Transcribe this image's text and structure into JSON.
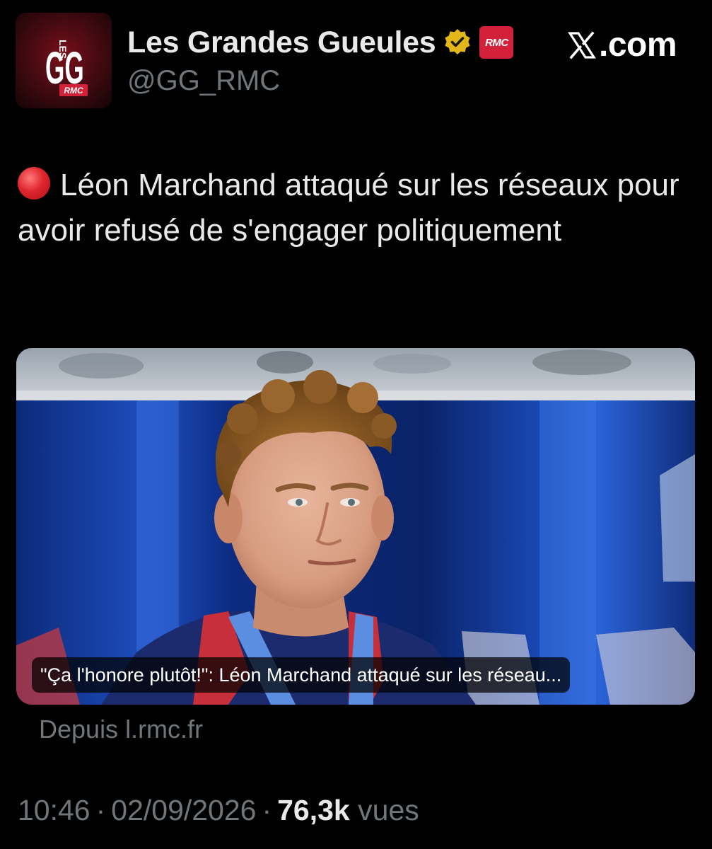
{
  "header": {
    "author_name": "Les Grandes Gueules",
    "author_handle": "@GG_RMC",
    "affiliate_badge": "RMC",
    "avatar_logo": {
      "big_letters": "GG",
      "small_text": "LES",
      "badge": "RMC"
    },
    "site_watermark": ".com"
  },
  "tweet": {
    "text": "Léon Marchand attaqué sur les réseaux pour avoir refusé de s'engager politiquement"
  },
  "card": {
    "caption": "\"Ça l'honore plutôt!\": Léon Marchand attaqué sur les réseau...",
    "source": "Depuis l.rmc.fr"
  },
  "meta": {
    "time": "10:46",
    "date": "02/09/2026",
    "views_count": "76,3k",
    "views_label": "vues",
    "separator": "·"
  },
  "colors": {
    "background": "#000000",
    "text": "#e7e9ea",
    "secondary_text": "#71767b",
    "rmc_red": "#d4213a",
    "verified_gold": "#e2b719"
  },
  "icons": [
    "avatar-logo",
    "verified-gold-icon",
    "rmc-affiliate-badge",
    "x-logo-icon",
    "red-circle-icon"
  ]
}
